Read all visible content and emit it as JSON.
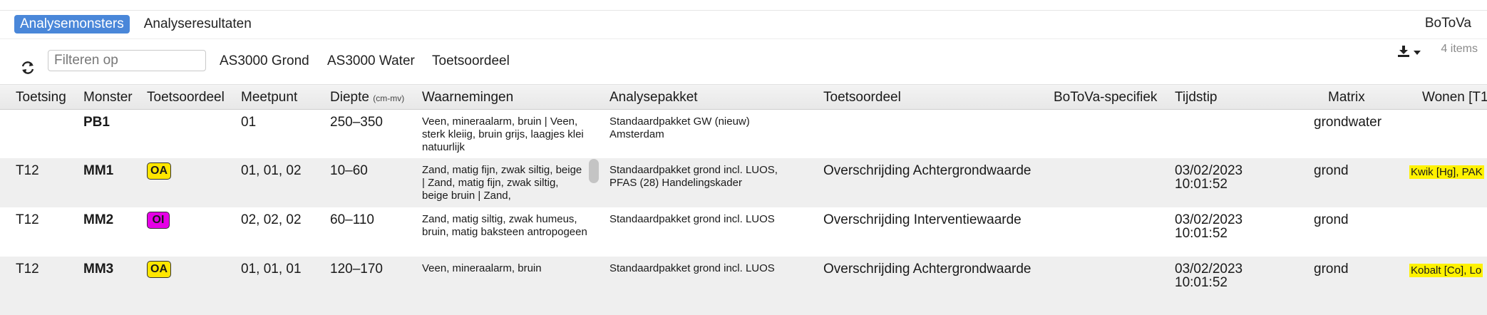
{
  "tabs": [
    {
      "label": "Analysemonsters",
      "active": true
    },
    {
      "label": "Analyseresultaten",
      "active": false
    }
  ],
  "brand": "BoToVa",
  "toolbar": {
    "filter_placeholder": "Filteren op",
    "buttons": [
      "AS3000 Grond",
      "AS3000 Water",
      "Toetsoordeel"
    ],
    "item_count": "4 items"
  },
  "columns": {
    "toetsing": "Toetsing",
    "monster": "Monster",
    "toetsoordeel_short": "Toetsoordeel",
    "meetpunt": "Meetpunt",
    "diepte": "Diepte",
    "diepte_unit": "(cm-mv)",
    "waarnemingen": "Waarnemingen",
    "analysepakket": "Analysepakket",
    "toetsoordeel": "Toetsoordeel",
    "botova": "BoToVa-specifiek",
    "tijdstip": "Tijdstip",
    "matrix": "Matrix",
    "wonen": "Wonen [T1"
  },
  "rows": [
    {
      "toetsing": "",
      "monster": "PB1",
      "badge": "",
      "meetpunt": "01",
      "diepte": "250–350",
      "waarnemingen": "Veen, mineraalarm, bruin | Veen, sterk kleiig, bruin grijs, laagjes klei natuurlijk",
      "analysepakket": "Standaardpakket GW (nieuw) Amsterdam",
      "toetsoordeel": "",
      "tijdstip_date": "",
      "tijdstip_time": "",
      "matrix": "grondwater",
      "wonen": ""
    },
    {
      "toetsing": "T12",
      "monster": "MM1",
      "badge": "OA",
      "meetpunt": "01, 01, 02",
      "diepte": "10–60",
      "waarnemingen": "Zand, matig fijn, zwak siltig, beige | Zand, matig fijn, zwak siltig, beige bruin | Zand,",
      "analysepakket": "Standaardpakket grond incl. LUOS, PFAS (28) Handelingskader",
      "toetsoordeel": "Overschrijding Achtergrondwaarde",
      "tijdstip_date": "03/02/2023",
      "tijdstip_time": "10:01:52",
      "matrix": "grond",
      "wonen": "Kwik [Hg], PAK"
    },
    {
      "toetsing": "T12",
      "monster": "MM2",
      "badge": "OI",
      "meetpunt": "02, 02, 02",
      "diepte": "60–110",
      "waarnemingen": "Zand, matig siltig, zwak humeus, bruin, matig baksteen antropogeen",
      "analysepakket": "Standaardpakket grond incl. LUOS",
      "toetsoordeel": "Overschrijding Interventiewaarde",
      "tijdstip_date": "03/02/2023",
      "tijdstip_time": "10:01:52",
      "matrix": "grond",
      "wonen": ""
    },
    {
      "toetsing": "T12",
      "monster": "MM3",
      "badge": "OA",
      "meetpunt": "01, 01, 01",
      "diepte": "120–170",
      "waarnemingen": "Veen, mineraalarm, bruin",
      "analysepakket": "Standaardpakket grond incl. LUOS",
      "toetsoordeel": "Overschrijding Achtergrondwaarde",
      "tijdstip_date": "03/02/2023",
      "tijdstip_time": "10:01:52",
      "matrix": "grond",
      "wonen": "Kobalt [Co], Lo"
    }
  ],
  "colors": {
    "tab_active": "#4a87d9",
    "badge_oa": "#ffe600",
    "badge_oi": "#e600e6",
    "highlight": "#fff200",
    "row_alt": "#efefef"
  },
  "icons": [
    "refresh-icon",
    "download-icon",
    "caret-down-icon"
  ]
}
